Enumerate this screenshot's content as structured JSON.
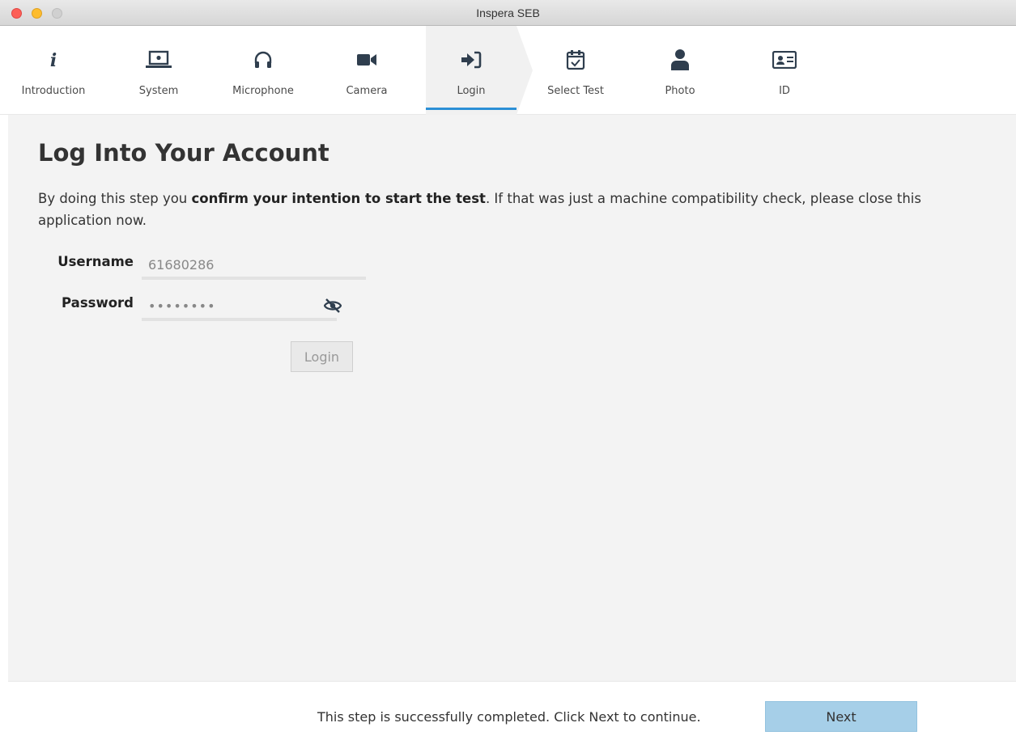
{
  "window": {
    "title": "Inspera SEB"
  },
  "steps": [
    {
      "label": "Introduction",
      "icon": "info-icon"
    },
    {
      "label": "System",
      "icon": "laptop-icon"
    },
    {
      "label": "Microphone",
      "icon": "headphones-icon"
    },
    {
      "label": "Camera",
      "icon": "video-camera-icon"
    },
    {
      "label": "Login",
      "icon": "sign-in-icon",
      "active": true
    },
    {
      "label": "Select Test",
      "icon": "calendar-check-icon"
    },
    {
      "label": "Photo",
      "icon": "user-icon"
    },
    {
      "label": "ID",
      "icon": "id-card-icon"
    }
  ],
  "main": {
    "heading": "Log Into Your Account",
    "intro_before": "By doing this step you ",
    "intro_bold": "confirm your intention to start the test",
    "intro_after": ". If that was just a machine compatibility check, please close this application now.",
    "username_label": "Username",
    "username_value": "61680286",
    "password_label": "Password",
    "password_value": "••••••••",
    "login_button": "Login"
  },
  "footer": {
    "status": "This step is successfully completed. Click Next to continue.",
    "next_button": "Next"
  },
  "colors": {
    "accent": "#2b8fd6",
    "next_button_bg": "#a6cfe8",
    "content_bg": "#f3f3f3"
  }
}
